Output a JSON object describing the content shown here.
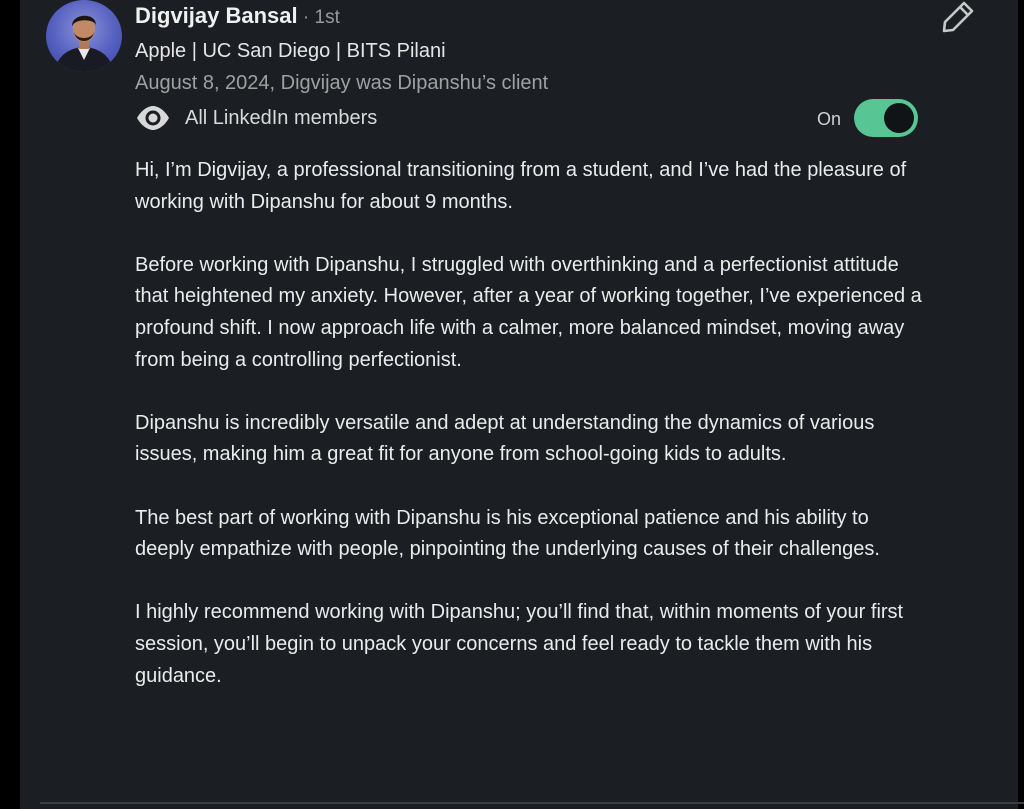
{
  "recommendation": {
    "author": {
      "name": "Digvijay Bansal",
      "connection_degree": " · 1st",
      "headline": "Apple | UC San Diego | BITS Pilani",
      "relation": "August 8, 2024, Digvijay was Dipanshu’s client"
    },
    "visibility": {
      "icon": "eye-icon",
      "label": "All LinkedIn members",
      "toggle_label": "On",
      "toggle_on": true
    },
    "edit_icon": "pencil-icon",
    "paragraphs": [
      "Hi, I’m Digvijay, a professional transitioning from a student, and I’ve had the pleasure of working with Dipanshu for about 9 months.",
      "Before working with Dipanshu, I struggled with overthinking and a perfectionist attitude that heightened my anxiety. However, after a year of working together, I’ve experienced a profound shift. I now approach life with a calmer, more balanced mindset, moving away from being a controlling perfectionist.",
      "Dipanshu is incredibly versatile and adept at understanding the dynamics of various issues, making him a great fit for anyone from school-going kids to adults.",
      "The best part of working with Dipanshu is his exceptional patience and his ability to deeply empathize with people, pinpointing the underlying causes of their challenges.",
      "I highly recommend working with Dipanshu; you’ll find that, within moments of your first session, you’ll begin to unpack your concerns and feel ready to tackle them with his guidance."
    ]
  },
  "colors": {
    "background": "#1b1f23",
    "toggle_on": "#57c594",
    "text_primary": "#ebebeb",
    "text_secondary": "#a0a0a0"
  }
}
